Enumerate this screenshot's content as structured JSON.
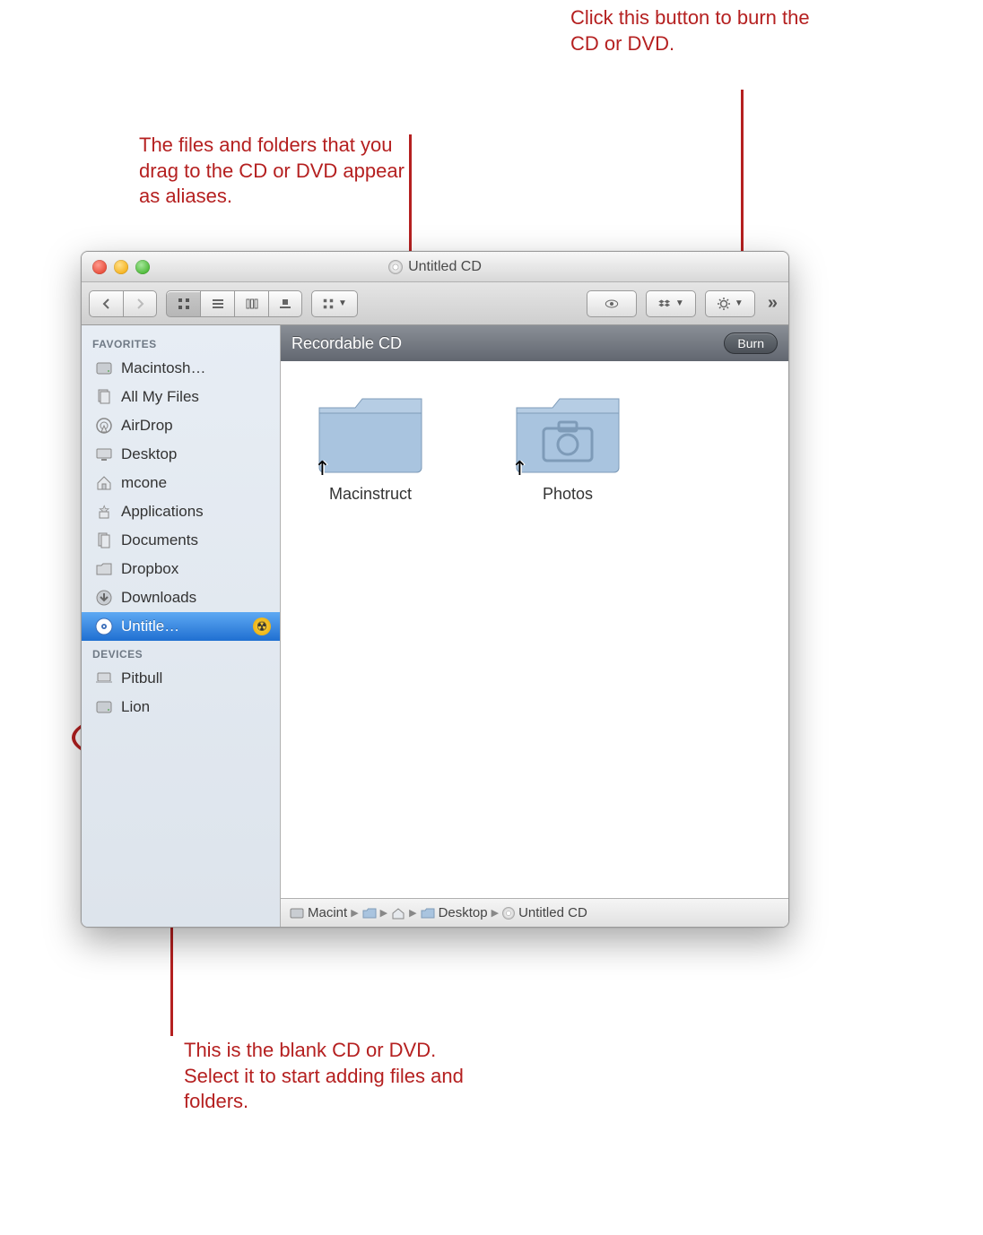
{
  "annotations": {
    "top_right": "Click this button to burn the CD or DVD.",
    "top_mid": "The files and folders that you drag to the CD or DVD appear as aliases.",
    "bottom": "This is the blank CD or DVD. Select it to start adding files and folders."
  },
  "window": {
    "title": "Untitled CD"
  },
  "sidebar": {
    "favorites_header": "FAVORITES",
    "devices_header": "DEVICES",
    "favorites": [
      {
        "icon": "hdd",
        "label": "Macintosh…"
      },
      {
        "icon": "allfiles",
        "label": "All My Files"
      },
      {
        "icon": "airdrop",
        "label": "AirDrop"
      },
      {
        "icon": "desktop",
        "label": "Desktop"
      },
      {
        "icon": "home",
        "label": "mcone"
      },
      {
        "icon": "apps",
        "label": "Applications"
      },
      {
        "icon": "docs",
        "label": "Documents"
      },
      {
        "icon": "folder",
        "label": "Dropbox"
      },
      {
        "icon": "downloads",
        "label": "Downloads"
      },
      {
        "icon": "disc",
        "label": "Untitle…",
        "selected": true,
        "burn": true
      }
    ],
    "devices": [
      {
        "icon": "laptop",
        "label": "Pitbull"
      },
      {
        "icon": "hdd",
        "label": "Lion"
      }
    ]
  },
  "main": {
    "header": "Recordable CD",
    "burn_label": "Burn",
    "folders": [
      {
        "label": "Macinstruct",
        "type": "plain"
      },
      {
        "label": "Photos",
        "type": "photo"
      }
    ]
  },
  "pathbar": {
    "items": [
      "Macint",
      "",
      "",
      "Desktop",
      "Untitled CD"
    ]
  }
}
